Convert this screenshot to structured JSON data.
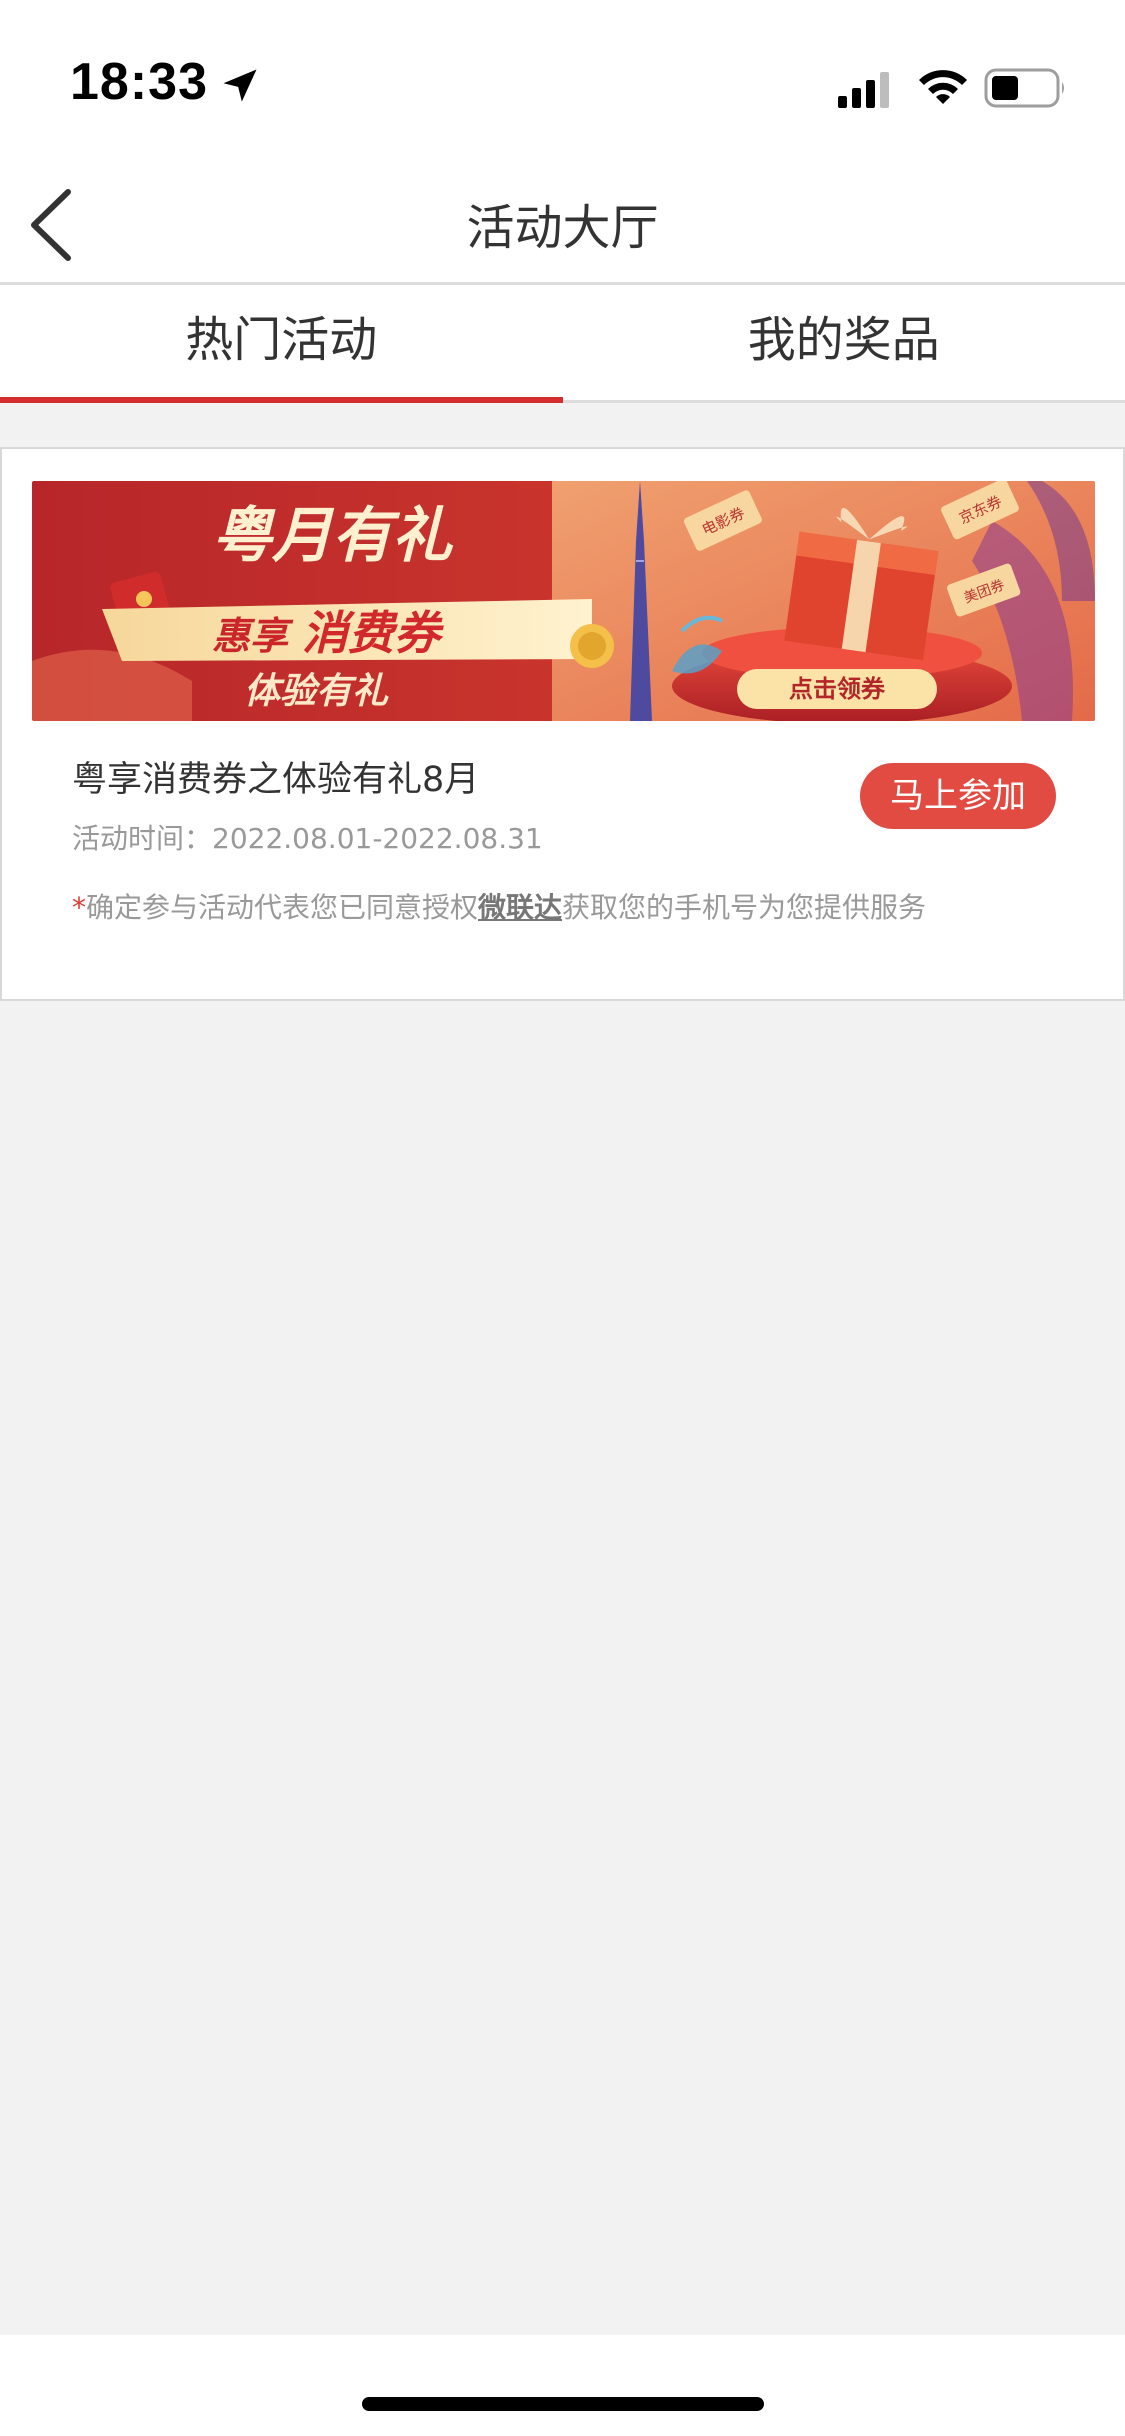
{
  "status_bar": {
    "time": "18:33",
    "icons": [
      "location-arrow-icon",
      "cellular-signal-icon",
      "wifi-icon",
      "battery-icon"
    ]
  },
  "nav": {
    "title": "活动大厅",
    "back_icon": "chevron-left-icon"
  },
  "tabs": [
    {
      "label": "热门活动",
      "active": true
    },
    {
      "label": "我的奖品",
      "active": false
    }
  ],
  "activity": {
    "banner": {
      "headline": "粤月有礼",
      "subline_prefix": "惠享",
      "subline_highlight": "消费券",
      "caption": "体验有礼",
      "cta": "点击领券",
      "tickets": [
        "电影券",
        "京东券",
        "美团券"
      ]
    },
    "title": "粤享消费券之体验有礼8月",
    "time": "活动时间：2022.08.01-2022.08.31",
    "join_label": "马上参加",
    "consent": {
      "star": "*",
      "before": "确定参与活动代表您已同意授权",
      "brand": "微联达",
      "after": "获取您的手机号为您提供服务"
    }
  },
  "colors": {
    "accent": "#d32d2f",
    "button": "#e14b42",
    "page_bg": "#f2f2f2"
  }
}
